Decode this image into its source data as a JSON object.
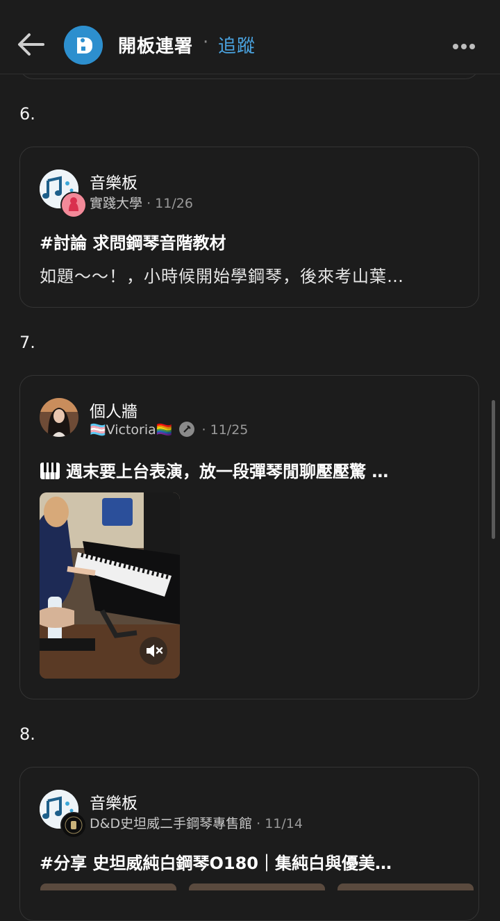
{
  "header": {
    "board_title": "開板連署",
    "separator": "·",
    "follow_label": "追蹤"
  },
  "items": [
    {
      "number": "6.",
      "board": "音樂板",
      "author": "實踐大學",
      "date": "11/26",
      "title": "#討論 求問鋼琴音階教材",
      "excerpt": "如題～～！，小時候開始學鋼琴，後來考山葉…"
    },
    {
      "number": "7.",
      "board": "個人牆",
      "author": "🏳️‍⚧️Victoria🏳️‍🌈",
      "date": "11/25",
      "title": "週末要上台表演，放一段彈琴閒聊壓壓驚 …",
      "title_icon": "piano-keys-icon",
      "media": {
        "type": "video",
        "muted": true
      }
    },
    {
      "number": "8.",
      "board": "音樂板",
      "author": "D&D史坦威二手鋼琴專售館",
      "date": "11/14",
      "title": "#分享 史坦威純白鋼琴O180｜集純白與優美…"
    }
  ],
  "colors": {
    "background": "#1c1c1c",
    "accent": "#4aa3e0",
    "logo": "#2d8fce",
    "card_border": "#343434"
  }
}
